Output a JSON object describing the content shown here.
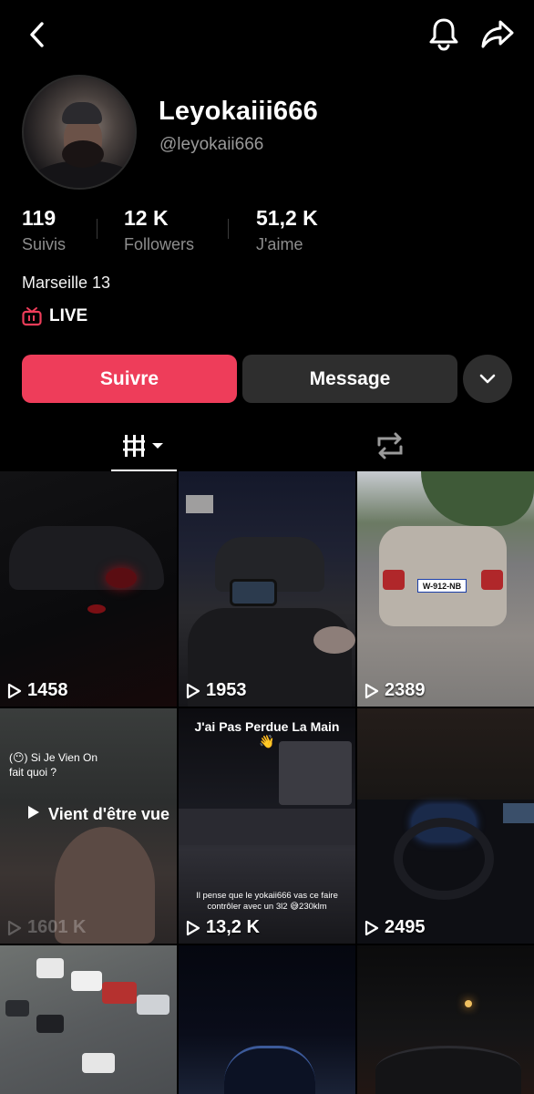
{
  "header": {
    "back_icon": "chevron-left-icon",
    "bell_icon": "bell-icon",
    "share_icon": "share-arrow-icon"
  },
  "profile": {
    "display_name": "Leyokaiii666",
    "handle": "@leyokaii666",
    "bio": "Marseille 13",
    "live_label": "LIVE",
    "live_icon": "tv-live-icon"
  },
  "stats": [
    {
      "value": "119",
      "label": "Suivis"
    },
    {
      "value": "12 K",
      "label": "Followers"
    },
    {
      "value": "51,2 K",
      "label": "J'aime"
    }
  ],
  "actions": {
    "follow_label": "Suivre",
    "message_label": "Message",
    "more_icon": "chevron-down-icon"
  },
  "tabs": {
    "videos_icon": "grid-videos-icon",
    "reposts_icon": "repost-icon"
  },
  "videos": [
    {
      "views": "1458"
    },
    {
      "views": "1953"
    },
    {
      "views": "2389",
      "plate": "W-912-NB"
    },
    {
      "views": "1601 K",
      "overlay_question": "(😶) Si Je Vien On fait quoi ?",
      "overlay_watched": "Vient d'être vue"
    },
    {
      "views": "13,2 K",
      "caption_top": "J'ai Pas Perdue La Main",
      "caption_top_emoji": "👋",
      "caption_bottom": "Il pense que le yokaii666 vas ce faire contrôler avec un 3l2 😅230klm"
    },
    {
      "views": "2495"
    },
    {},
    {},
    {}
  ],
  "colors": {
    "background": "#000000",
    "follow_button": "#ee3d5a",
    "secondary_button": "#2e2e2e",
    "muted_text": "#8d8d8d",
    "live_icon": "#ee3d5a"
  }
}
